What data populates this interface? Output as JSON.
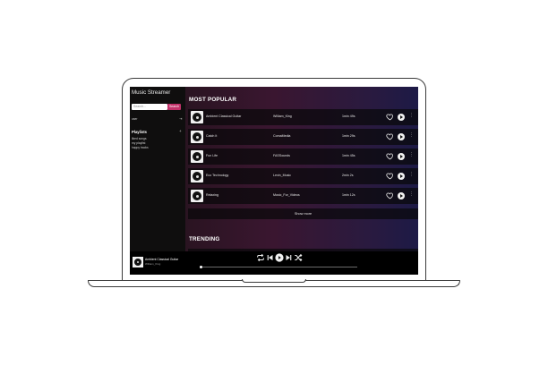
{
  "app": {
    "title": "Music Streamer"
  },
  "search": {
    "placeholder": "Search...",
    "button_label": "Search"
  },
  "sidebar": {
    "first_item": "user",
    "playlists_header": "Playlists",
    "playlists_add": "+",
    "playlists": [
      "liked songs",
      "my playlist",
      "happy tracks"
    ]
  },
  "sections": {
    "most_popular": "MOST POPULAR",
    "trending": "TRENDING"
  },
  "tracks": [
    {
      "title": "Ambient Classical Guitar",
      "artist": "William_King",
      "duration": "1min 49s"
    },
    {
      "title": "Catch It",
      "artist": "ComaMedia",
      "duration": "1min 29s"
    },
    {
      "title": "Fun Life",
      "artist": "FASSounds",
      "duration": "1min 45s"
    },
    {
      "title": "Eco Technology",
      "artist": "Lexin_Music",
      "duration": "2min 2s"
    },
    {
      "title": "Relaxing",
      "artist": "Music_For_Videos",
      "duration": "1min 12s"
    }
  ],
  "show_more_label": "Show more",
  "now_playing": {
    "title": "Ambient Classical Guitar",
    "artist": "William_King",
    "progress": 0.01
  },
  "icons": {
    "repeat": "repeat-icon",
    "prev": "skip-back-icon",
    "play": "play-icon",
    "next": "skip-forward-icon",
    "shuffle": "shuffle-icon",
    "heart": "heart-icon",
    "more": "more-vertical-icon",
    "disc": "disc-icon"
  },
  "colors": {
    "accent": "#c2326a",
    "background": "#0c0c0c"
  }
}
